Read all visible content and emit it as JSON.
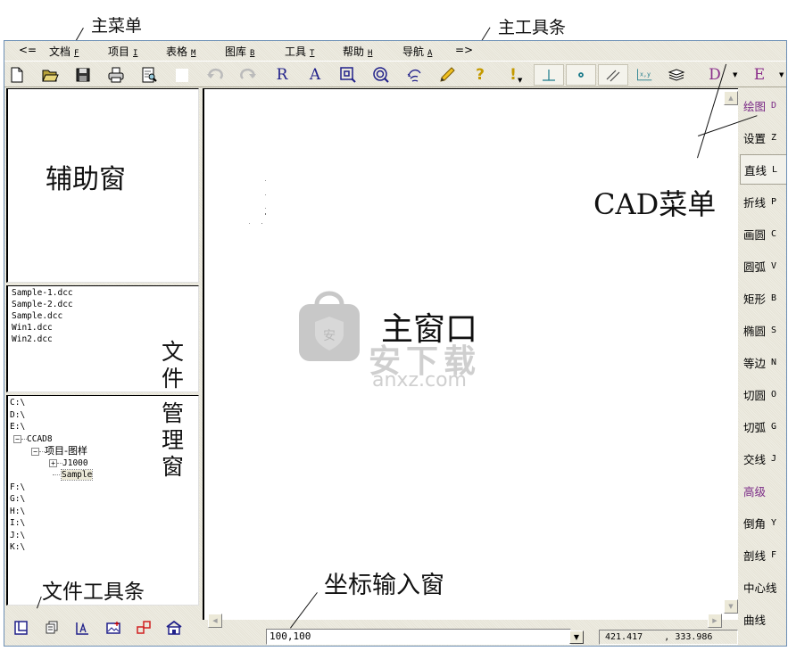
{
  "annotations": {
    "main_menu": "主菜单",
    "main_toolbar": "主工具条",
    "aux_window": "辅助窗",
    "cad_menu": "CAD菜单",
    "main_window": "主窗口",
    "file_manager_1": "文",
    "file_manager_2": "件",
    "file_manager_3": "管",
    "file_manager_4": "理",
    "file_manager_5": "窗",
    "file_toolbar": "文件工具条",
    "coord_input_window": "坐标输入窗"
  },
  "watermark": {
    "text": "安下载",
    "url_text": "anxz.com",
    "badge_char": "安"
  },
  "menubar": {
    "back": "<=",
    "forward": "=>",
    "items": [
      {
        "label": "文档",
        "key": "F"
      },
      {
        "label": "项目",
        "key": "I"
      },
      {
        "label": "表格",
        "key": "M"
      },
      {
        "label": "图库",
        "key": "B"
      },
      {
        "label": "工具",
        "key": "T"
      },
      {
        "label": "帮助",
        "key": "H"
      },
      {
        "label": "导航",
        "key": "A"
      }
    ]
  },
  "toolbar": {
    "icons": [
      "new-file-icon",
      "open-folder-icon",
      "save-icon",
      "print-icon",
      "print-preview-icon",
      "blank-icon",
      "undo-icon",
      "redo-icon",
      "redraw-r-icon",
      "text-a-icon",
      "zoom-window-icon",
      "zoom-icon",
      "pan-hand-icon",
      "pencil-icon",
      "help-icon",
      "alert-icon",
      "perpendicular-snap-icon",
      "point-snap-icon",
      "parallel-snap-icon",
      "xy-coord-icon",
      "layers-icon",
      "cad-menu-d-icon",
      "cad-menu-e-icon"
    ],
    "letter_r": "R",
    "letter_a": "A",
    "xy_label": "x,y",
    "menu_d": "D",
    "menu_e": "E",
    "help_glyph": "?",
    "alert_glyph": "!"
  },
  "files": [
    "Sample-1.dcc",
    "Sample-2.dcc",
    "Sample.dcc",
    "Win1.dcc",
    "Win2.dcc"
  ],
  "tree": {
    "drives_top": [
      "C:\\",
      "D:\\",
      "E:\\"
    ],
    "folder": "CCAD8",
    "subfolder": "项目-图样",
    "children": [
      "J1000",
      "Sample"
    ],
    "selected": "Sample",
    "drives_bottom": [
      "F:\\",
      "G:\\",
      "H:\\",
      "I:\\",
      "J:\\",
      "K:\\"
    ]
  },
  "file_toolbar": {
    "icons": [
      "new-window-icon",
      "copy-window-icon",
      "text-style-icon",
      "image-add-icon",
      "block-icon",
      "home-icon"
    ]
  },
  "coord": {
    "input_value": "100,100",
    "readout_x": "421.417",
    "readout_y": "333.986",
    "separator": ","
  },
  "cad_menu": {
    "items": [
      {
        "label": "绘图",
        "key": "D",
        "type": "header"
      },
      {
        "label": "设置",
        "key": "Z",
        "type": "item"
      },
      {
        "label": "直线",
        "key": "L",
        "type": "active"
      },
      {
        "label": "折线",
        "key": "P",
        "type": "item"
      },
      {
        "label": "画圆",
        "key": "C",
        "type": "item"
      },
      {
        "label": "圆弧",
        "key": "V",
        "type": "item"
      },
      {
        "label": "矩形",
        "key": "B",
        "type": "item"
      },
      {
        "label": "椭圆",
        "key": "S",
        "type": "item"
      },
      {
        "label": "等边",
        "key": "N",
        "type": "item"
      },
      {
        "label": "切圆",
        "key": "O",
        "type": "item"
      },
      {
        "label": "切弧",
        "key": "G",
        "type": "item"
      },
      {
        "label": "交线",
        "key": "J",
        "type": "item"
      },
      {
        "label": "高级",
        "key": "",
        "type": "header"
      },
      {
        "label": "倒角",
        "key": "Y",
        "type": "item"
      },
      {
        "label": "剖线",
        "key": "F",
        "type": "item"
      },
      {
        "label": "中心线",
        "key": "",
        "type": "item"
      },
      {
        "label": "曲线",
        "key": "",
        "type": "item"
      }
    ]
  },
  "colors": {
    "window_border": "#6d8fb5",
    "panel_bg": "#e6e3d6",
    "cad_header": "#7a2a86",
    "icon_blue": "#20208a",
    "snap_teal": "#1a7a8a"
  }
}
